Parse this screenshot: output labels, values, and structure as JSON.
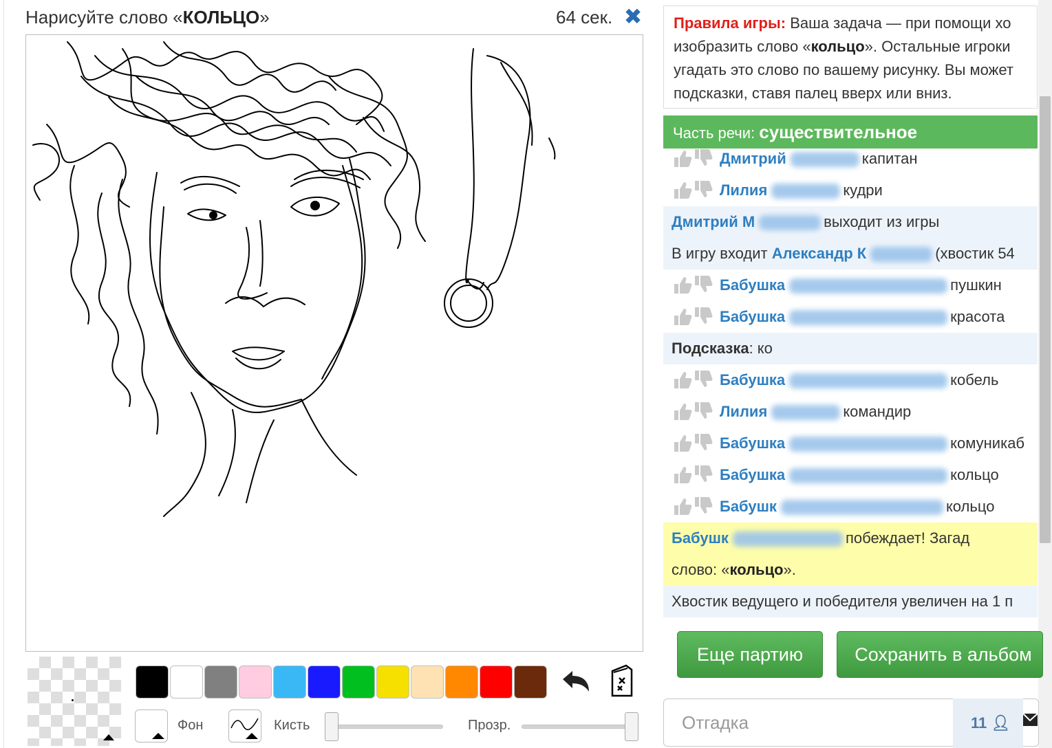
{
  "header": {
    "task_prefix": "Нарисуйте слово «",
    "task_word": "КОЛЬЦО",
    "task_suffix": "»",
    "timer": "64 сек.",
    "close_icon": "close-x-icon"
  },
  "palette": {
    "colors": [
      "#000000",
      "#ffffff",
      "#808080",
      "#ffcce0",
      "#3ab8f5",
      "#1a1aff",
      "#00bf1f",
      "#f5e000",
      "#ffe2b3",
      "#ff8800",
      "#ff0000",
      "#6b2a0b"
    ],
    "undo_icon": "undo-arrow-icon",
    "clear_icon": "clear-canvas-icon"
  },
  "tools": {
    "background_label": "Фон",
    "brush_label": "Кисть",
    "opacity_label": "Прозр.",
    "brush_size": 0,
    "opacity": 1
  },
  "rules": {
    "title": "Правила игры:",
    "line1": " Ваша задача — при помощи хо",
    "line2_prefix": "изобразить слово «",
    "line2_word": "кольцо",
    "line2_suffix": "». Остальные игроки",
    "line3": "угадать это слово по вашему рисунку. Вы может",
    "line4": "подсказки, ставя палец вверх или вниз."
  },
  "part_of_speech": {
    "label": "Часть речи: ",
    "value": "существительное"
  },
  "chat": {
    "rows": [
      {
        "type": "guess",
        "name": "Дмитрий",
        "text": "капитан"
      },
      {
        "type": "guess",
        "name": "Лилия",
        "text": "кудри"
      },
      {
        "type": "leave",
        "name": "Дмитрий М",
        "text": "выходит из игры"
      },
      {
        "type": "join",
        "prefix": "В игру входит ",
        "name": "Александр К",
        "text": "(хвостик 54"
      },
      {
        "type": "guess",
        "name": "Бабушка",
        "text": "пушкин"
      },
      {
        "type": "guess",
        "name": "Бабушка",
        "text": "красота"
      },
      {
        "type": "hint",
        "label": "Подсказка",
        "text": ": ко"
      },
      {
        "type": "guess",
        "name": "Бабушка",
        "text": "кобель"
      },
      {
        "type": "guess",
        "name": "Лилия",
        "text": "командир"
      },
      {
        "type": "guess",
        "name": "Бабушка",
        "text": "комуникаб"
      },
      {
        "type": "guess",
        "name": "Бабушка",
        "text": "кольцо"
      },
      {
        "type": "guess",
        "name": "Бабушк",
        "text": "кольцо"
      }
    ],
    "winner_name": "Бабушк",
    "winner_text": "побеждает! Загад",
    "winner_line2_prefix": "слово: «",
    "winner_word": "кольцо",
    "winner_line2_suffix": "».",
    "tail_text": "Хвостик ведущего и победителя увеличен на 1 п"
  },
  "buttons": {
    "more_game": "Еще партию",
    "save_album": "Сохранить в альбом"
  },
  "guess_input": {
    "placeholder": "Отгадка"
  },
  "online_count": "11"
}
